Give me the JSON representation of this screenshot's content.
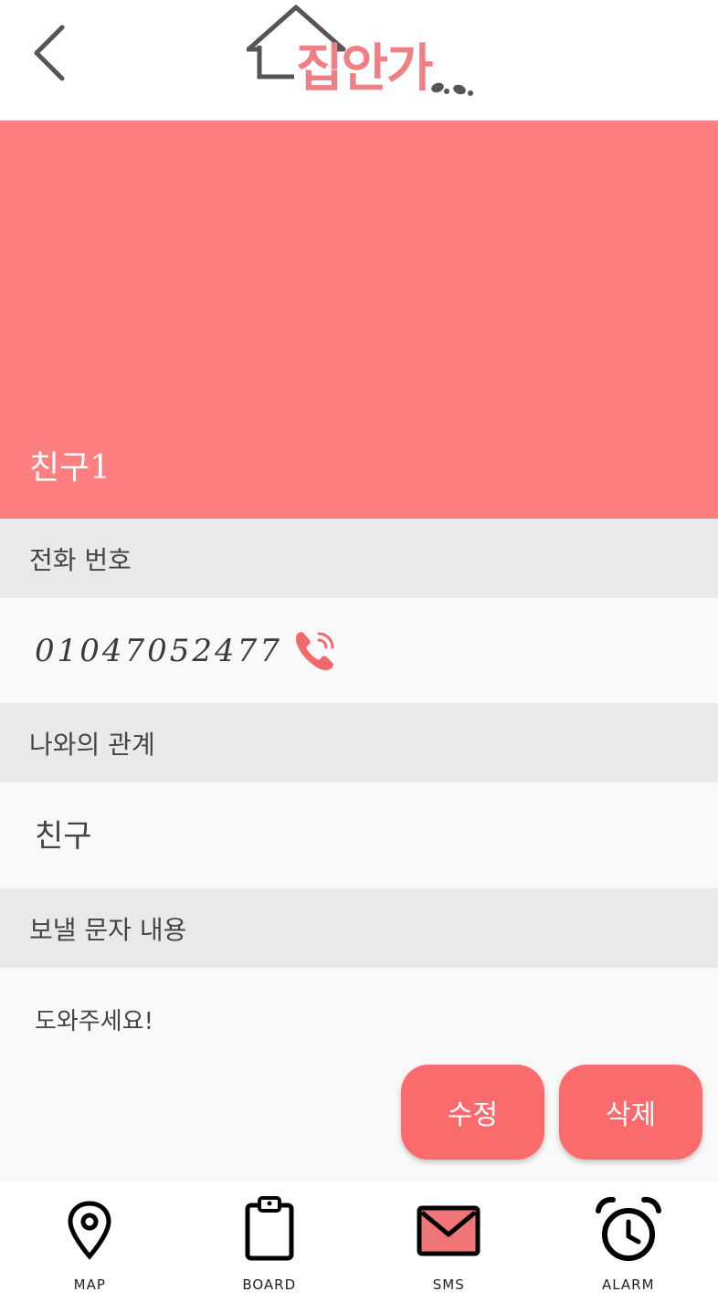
{
  "header": {
    "logo_text": "집안가",
    "back_icon": "chevron-left-icon"
  },
  "hero": {
    "name": "친구1",
    "background_color": "#fe7f7f"
  },
  "phone": {
    "heading": "전화 번호",
    "number": "01047052477",
    "call_icon": "phone-call-icon"
  },
  "relation": {
    "heading": "나와의 관계",
    "value": "친구"
  },
  "message": {
    "heading": "보낼 문자 내용",
    "value": "도와주세요!"
  },
  "actions": {
    "edit_label": "수정",
    "delete_label": "삭제",
    "accent_color": "#fb6b6d"
  },
  "nav": {
    "items": [
      {
        "label": "MAP",
        "icon": "map-pin-icon"
      },
      {
        "label": "BOARD",
        "icon": "clipboard-icon"
      },
      {
        "label": "SMS",
        "icon": "envelope-icon"
      },
      {
        "label": "ALARM",
        "icon": "alarm-clock-icon"
      }
    ]
  }
}
